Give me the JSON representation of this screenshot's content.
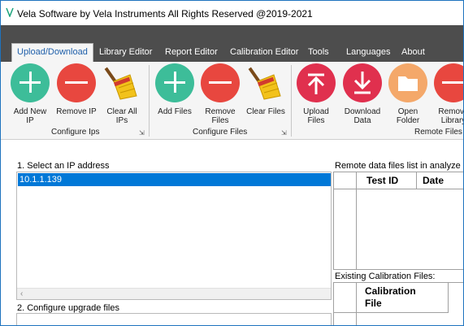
{
  "window": {
    "title": "Vela Software by Vela Instruments All Rights Reserved @2019-2021"
  },
  "tabs": [
    {
      "label": "Upload/Download",
      "active": true
    },
    {
      "label": "Library Editor"
    },
    {
      "label": "Report Editor"
    },
    {
      "label": "Calibration Editor"
    },
    {
      "label": "Tools"
    },
    {
      "label": "Languages"
    },
    {
      "label": "About"
    }
  ],
  "ribbon": {
    "groups": [
      {
        "label": "Configure Ips"
      },
      {
        "label": "Configure Files"
      },
      {
        "label": "Remote Files C"
      }
    ],
    "buttons": [
      {
        "label": "Add New\nIP",
        "icon": "plus-icon",
        "color": "#3dbd99"
      },
      {
        "label": "Remove IP",
        "icon": "minus-icon",
        "color": "#e8473f"
      },
      {
        "label": "Clear All\nIPs",
        "icon": "broom-icon"
      },
      {
        "label": "Add Files",
        "icon": "plus-icon",
        "color": "#3dbd99"
      },
      {
        "label": "Remove\nFiles",
        "icon": "minus-icon",
        "color": "#e8473f"
      },
      {
        "label": "Clear Files",
        "icon": "broom-icon"
      },
      {
        "label": "Upload\nFiles",
        "icon": "upload-icon",
        "color": "#e0304e"
      },
      {
        "label": "Download\nData",
        "icon": "download-icon",
        "color": "#e0304e"
      },
      {
        "label": "Open\nFolder",
        "icon": "folder-icon",
        "color": "#f4a86a"
      },
      {
        "label": "Remove\nLibrary",
        "icon": "minus-icon",
        "color": "#e8473f"
      }
    ]
  },
  "main": {
    "select_ip_label": "1. Select an IP address",
    "ip_addresses": [
      "10.1.1.139"
    ],
    "configure_upgrade_label": "2. Configure upgrade files",
    "remote_files_label": "Remote data files list in analyze",
    "remote_columns": [
      "Test ID",
      "Date"
    ],
    "calibration_label": "Existing Calibration Files:",
    "calibration_columns": [
      "Calibration\nFile"
    ]
  },
  "colors": {
    "accent": "#0078d7",
    "ribbon_tab_bar": "#4d4d4d"
  }
}
